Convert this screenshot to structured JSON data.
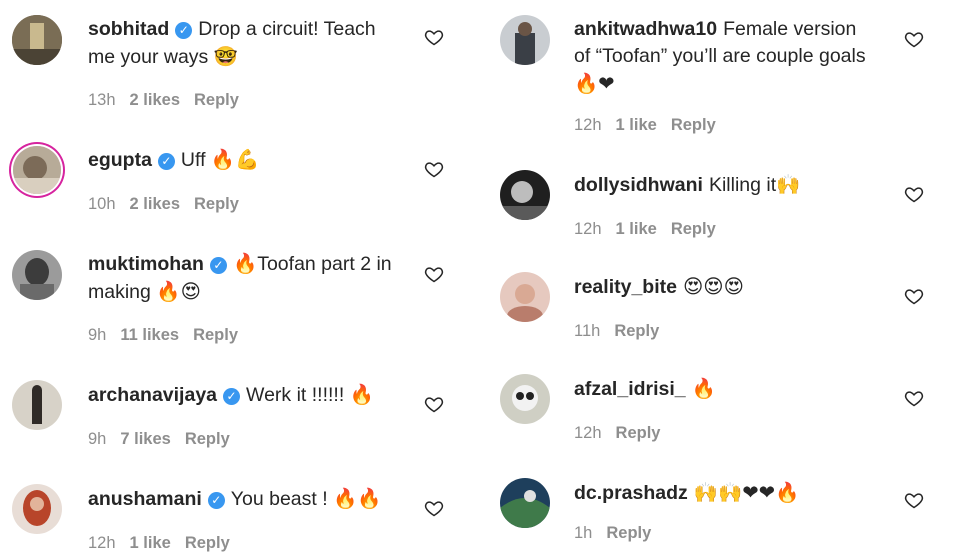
{
  "left": [
    {
      "user": "sobhitad",
      "verified": true,
      "text": "Drop a circuit! Teach me your ways",
      "emoji": "🤓",
      "time": "13h",
      "likes": "2 likes",
      "reply": "Reply",
      "avatar_color": "#6b5f4a"
    },
    {
      "user": "egupta",
      "verified": true,
      "text": "Uff",
      "emoji": "🔥💪",
      "time": "10h",
      "likes": "2 likes",
      "reply": "Reply",
      "avatar_color": "#a89a86"
    },
    {
      "user": "muktimohan",
      "verified": true,
      "text": "🔥Toofan part 2 in making",
      "emoji": "🔥😍",
      "time": "9h",
      "likes": "11 likes",
      "reply": "Reply",
      "avatar_color": "#5a5a5a"
    },
    {
      "user": "archanavijaya",
      "verified": true,
      "text": "Werk it !!!!!!",
      "emoji": "🔥",
      "time": "9h",
      "likes": "7 likes",
      "reply": "Reply",
      "avatar_color": "#8a7f72"
    },
    {
      "user": "anushamani",
      "verified": true,
      "text": "You beast !",
      "emoji": "🔥🔥",
      "time": "12h",
      "likes": "1 like",
      "reply": "Reply",
      "avatar_color": "#b04a2f"
    }
  ],
  "right": [
    {
      "user": "ankitwadhwa10",
      "verified": false,
      "text": "Female version of “Toofan” you’ll are couple goals",
      "emoji": "🔥❤",
      "time": "12h",
      "likes": "1 like",
      "reply": "Reply",
      "avatar_color": "#4a4f55"
    },
    {
      "user": "dollysidhwani",
      "verified": false,
      "text": "Killing it",
      "emoji": "🙌",
      "time": "12h",
      "likes": "1 like",
      "reply": "Reply",
      "avatar_color": "#2c2c2c"
    },
    {
      "user": "reality_bite",
      "verified": false,
      "text": "",
      "emoji": "😍😍😍",
      "time": "11h",
      "likes": "",
      "reply": "Reply",
      "avatar_color": "#c89a86"
    },
    {
      "user": "afzal_idrisi_",
      "verified": false,
      "text": "",
      "emoji": "🔥",
      "time": "12h",
      "likes": "",
      "reply": "Reply",
      "avatar_color": "#9a9a8a"
    },
    {
      "user": "dc.prashadz",
      "verified": false,
      "text": "",
      "emoji": "🙌🙌❤❤🔥",
      "time": "1h",
      "likes": "",
      "reply": "Reply",
      "avatar_color": "#2a5a7a"
    }
  ],
  "icons": {
    "verified": "verified-badge-icon",
    "like": "heart-outline-icon"
  },
  "colors": {
    "text": "#262626",
    "meta": "#8e8e8e",
    "verified": "#3897f0",
    "story_ring": "#d6249f"
  }
}
